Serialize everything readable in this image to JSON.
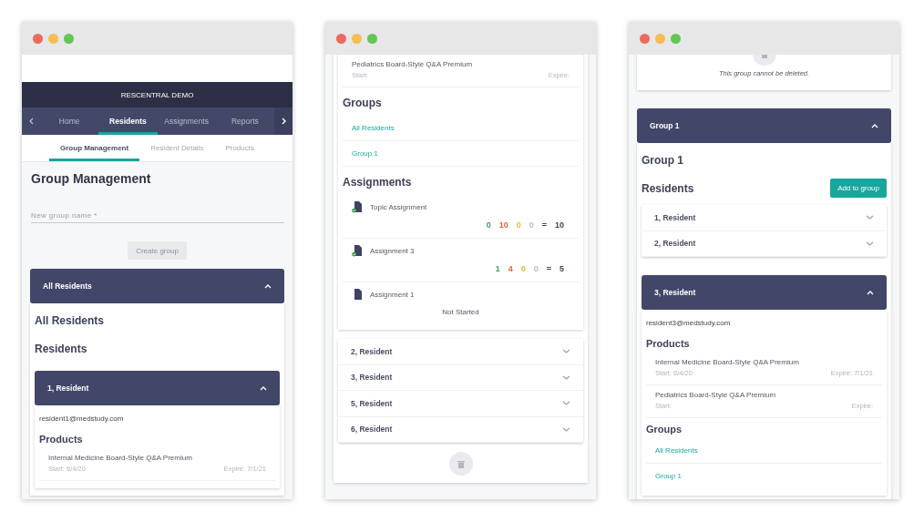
{
  "screens": [
    {
      "blocks": [
        {
          "kind": "brand_bar",
          "title": "RESCENTRAL DEMO"
        },
        {
          "kind": "nav_tabs",
          "items": [
            {
              "label": "Home",
              "selected": false
            },
            {
              "label": "Residents",
              "selected": true
            },
            {
              "label": "Assignments",
              "selected": false
            },
            {
              "label": "Reports",
              "selected": false
            }
          ]
        },
        {
          "kind": "sub_tabs",
          "items": [
            {
              "label": "Group Management",
              "selected": true
            },
            {
              "label": "Resident Details",
              "selected": false
            },
            {
              "label": "Products",
              "selected": false
            }
          ]
        },
        {
          "kind": "page_title",
          "text": "Group Management"
        },
        {
          "kind": "text_field",
          "placeholder": "New group name *"
        },
        {
          "kind": "button",
          "label": "Create group",
          "disabled": true
        },
        {
          "kind": "accordion_group",
          "items": [
            {
              "title": "All Residents",
              "expanded": true,
              "children": [
                {
                  "kind": "section_title",
                  "text": "All Residents"
                },
                {
                  "kind": "section_title",
                  "text": "Residents"
                },
                {
                  "kind": "accordion_group",
                  "items": [
                    {
                      "title": "1, Resident",
                      "expanded": true,
                      "children": [
                        {
                          "kind": "email",
                          "text": "resident1@medstudy.com"
                        },
                        {
                          "kind": "sub_title",
                          "text": "Products"
                        },
                        {
                          "kind": "product",
                          "name": "Internal Medicine Board-Style Q&A Premium",
                          "start": "Start: 6/4/20",
                          "expire": "Expire: 7/1/21"
                        }
                      ]
                    }
                  ]
                }
              ]
            }
          ]
        }
      ]
    },
    {
      "blocks": [
        {
          "kind": "card",
          "children": [
            {
              "kind": "card",
              "children": [
                {
                  "kind": "product",
                  "name": "Pediatrics Board-Style Q&A Premium",
                  "start": "Start:",
                  "expire": "Expire:"
                },
                {
                  "kind": "section_title",
                  "text": "Groups"
                },
                {
                  "kind": "links",
                  "items": [
                    "All Residents",
                    "Group 1"
                  ]
                },
                {
                  "kind": "section_title",
                  "text": "Assignments"
                },
                {
                  "kind": "assignment",
                  "name": "Topic Assignment",
                  "completed": true,
                  "counts": [
                    {
                      "value": "0",
                      "color": "#3f9a4f"
                    },
                    {
                      "value": "10",
                      "color": "#e0643b"
                    },
                    {
                      "value": "0",
                      "color": "#f5b330"
                    },
                    {
                      "value": "0",
                      "color": "#bbbbbb"
                    }
                  ],
                  "separator": "=",
                  "total": "10"
                },
                {
                  "kind": "assignment",
                  "name": "Assignment 3",
                  "completed": true,
                  "counts": [
                    {
                      "value": "1",
                      "color": "#3f9a4f"
                    },
                    {
                      "value": "4",
                      "color": "#e0643b"
                    },
                    {
                      "value": "0",
                      "color": "#f5b330"
                    },
                    {
                      "value": "0",
                      "color": "#bbbbbb"
                    }
                  ],
                  "separator": "=",
                  "total": "5"
                },
                {
                  "kind": "assignment",
                  "name": "Assignment 1",
                  "completed": false,
                  "status": "Not Started"
                }
              ]
            },
            {
              "kind": "accordion_group",
              "items": [
                {
                  "title": "2, Resident",
                  "expanded": false
                },
                {
                  "title": "3, Resident",
                  "expanded": false
                },
                {
                  "title": "5, Resident",
                  "expanded": false
                },
                {
                  "title": "6, Resident",
                  "expanded": false
                }
              ]
            },
            {
              "kind": "delete_icon"
            }
          ]
        }
      ]
    },
    {
      "blocks": [
        {
          "kind": "card",
          "children": [
            {
              "kind": "delete_icon"
            },
            {
              "kind": "note",
              "text": "This group cannot be deleted."
            }
          ]
        },
        {
          "kind": "accordion_group",
          "items": [
            {
              "title": "Group 1",
              "expanded": true,
              "children": [
                {
                  "kind": "section_title",
                  "text": "Group 1"
                },
                {
                  "kind": "section_title",
                  "text": "Residents",
                  "action": "Add to group"
                },
                {
                  "kind": "accordion_group",
                  "items": [
                    {
                      "title": "1, Resident",
                      "expanded": false
                    },
                    {
                      "title": "2, Resident",
                      "expanded": false
                    },
                    {
                      "title": "3, Resident",
                      "expanded": true,
                      "children": [
                        {
                          "kind": "email",
                          "text": "resident3@medstudy.com"
                        },
                        {
                          "kind": "sub_title",
                          "text": "Products"
                        },
                        {
                          "kind": "product",
                          "name": "Internal Medicine Board-Style Q&A Premium",
                          "start": "Start: 6/4/20",
                          "expire": "Expire: 7/1/21"
                        },
                        {
                          "kind": "product",
                          "name": "Pediatrics Board-Style Q&A Premium",
                          "start": "Start:",
                          "expire": "Expire:"
                        },
                        {
                          "kind": "sub_title",
                          "text": "Groups"
                        },
                        {
                          "kind": "links",
                          "items": [
                            "All Residents",
                            "Group 1"
                          ]
                        }
                      ]
                    }
                  ]
                }
              ]
            }
          ]
        }
      ]
    }
  ]
}
